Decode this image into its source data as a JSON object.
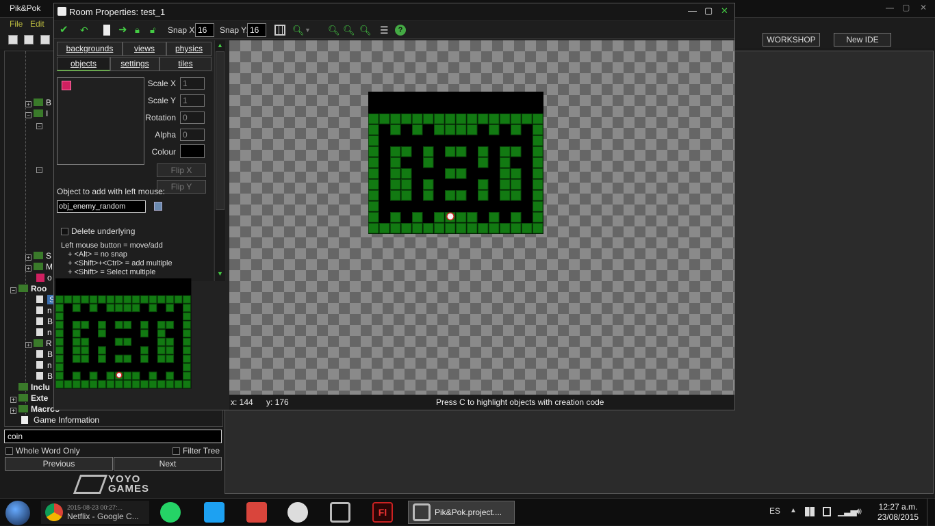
{
  "main_window": {
    "title": "Pik&Pok",
    "menu": [
      "File",
      "Edit"
    ],
    "right_buttons": [
      "WORKSHOP",
      "New IDE"
    ]
  },
  "tree": {
    "items": [
      "B",
      "I",
      "S",
      "M",
      "o",
      "Roo",
      "Inclu",
      "Exte",
      "Macros",
      "Game Information",
      "R",
      "B",
      "n",
      "B",
      "n",
      "B",
      "n",
      "S"
    ]
  },
  "search": {
    "value": "coin",
    "whole_word_only": "Whole Word Only",
    "filter_tree": "Filter Tree",
    "previous": "Previous",
    "next": "Next"
  },
  "logo": {
    "text1": "YOYO",
    "text2": "GAMES"
  },
  "dialog": {
    "title": "Room Properties: test_1",
    "snap_x_label": "Snap X:",
    "snap_x": "16",
    "snap_y_label": "Snap Y:",
    "snap_y": "16",
    "tabs": {
      "row1": [
        "backgrounds",
        "views",
        "physics"
      ],
      "row2": [
        "objects",
        "settings",
        "tiles"
      ]
    },
    "props": {
      "scale_x_label": "Scale X",
      "scale_x": "1",
      "scale_y_label": "Scale Y",
      "scale_y": "1",
      "rotation_label": "Rotation",
      "rotation": "0",
      "alpha_label": "Alpha",
      "alpha": "0",
      "colour_label": "Colour",
      "flip_x": "Flip X",
      "flip_y": "Flip Y"
    },
    "object_to_add_label": "Object to add with left mouse:",
    "object_value": "obj_enemy_random",
    "delete_underlying": "Delete underlying",
    "help_lines": [
      "Left mouse button = move/add",
      "+ <Alt> = no snap",
      "+ <Shift>+<Ctrl> = add multiple",
      "+ <Shift> = Select multiple"
    ],
    "status": {
      "x": "x: 144",
      "y": "y: 176",
      "hint": "Press C to highlight objects with creation code"
    }
  },
  "taskbar": {
    "items": [
      {
        "label": "2015-08-23 00:27:...",
        "sub": "Netflix - Google C..."
      },
      {
        "label": "Pik&Pok.project...."
      }
    ],
    "lang": "ES",
    "time": "12:27 a.m.",
    "date": "23/08/2015"
  },
  "colors": {
    "accent_green": "#6aa84f",
    "wall_green": "#127a12",
    "checker_dark": "#666666",
    "checker_light": "#8a8a8a"
  }
}
